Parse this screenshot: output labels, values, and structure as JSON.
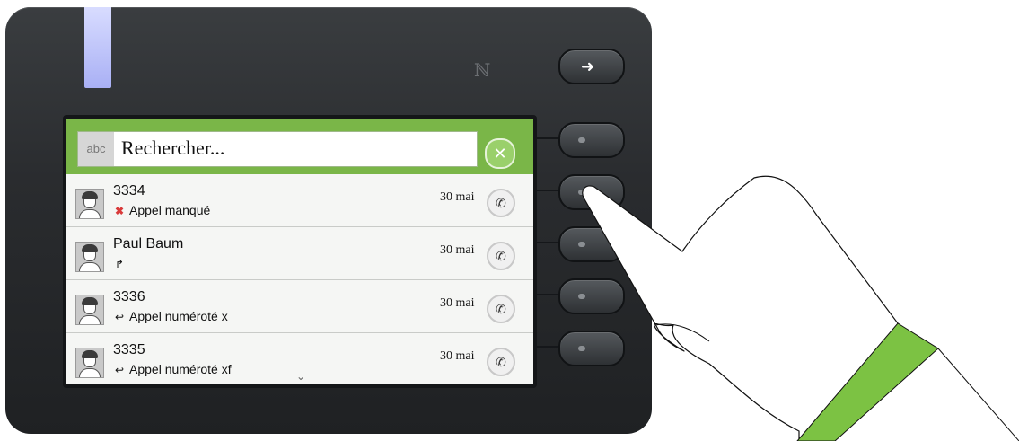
{
  "search": {
    "mode_label": "abc",
    "text": "Rechercher...",
    "clear_icon": "✕"
  },
  "entries": [
    {
      "name": "3334",
      "detail": "Appel manqué",
      "icon": "missed-call-icon",
      "date": "30 mai"
    },
    {
      "name": "Paul Baum",
      "detail": "",
      "icon": "forward-icon",
      "date": "30 mai"
    },
    {
      "name": "3336",
      "detail": "Appel numéroté x",
      "icon": "outgoing-call-icon",
      "date": "30 mai"
    },
    {
      "name": "3335",
      "detail": "Appel numéroté xf",
      "icon": "outgoing-call-icon",
      "date": "30 mai"
    }
  ],
  "colors": {
    "accent": "#7ab648",
    "missed": "#d93a3a",
    "led": "#a9b0f5",
    "cuff": "#7cc243"
  }
}
